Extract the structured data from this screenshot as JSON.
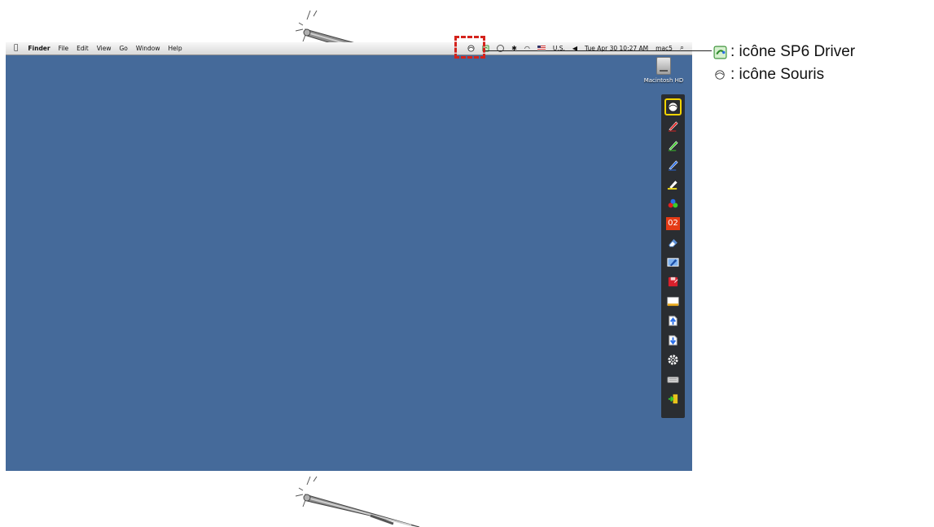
{
  "menubar": {
    "items": [
      "Finder",
      "File",
      "Edit",
      "View",
      "Go",
      "Window",
      "Help"
    ],
    "input_source": "U.S.",
    "clock": "Tue Apr 30  10:27 AM",
    "user": "mac5"
  },
  "desktop": {
    "hd_label": "Macintosh HD"
  },
  "toolbar": {
    "page_counter": "02",
    "tools": [
      "mouse-icon",
      "red-pen-icon",
      "green-pen-icon",
      "blue-pen-icon",
      "highlighter-icon",
      "color-palette-icon",
      "page-counter",
      "eraser-icon",
      "screen-capture-icon",
      "save-icon",
      "whiteboard-icon",
      "previous-page-icon",
      "next-page-icon",
      "settings-icon",
      "keyboard-icon",
      "exit-icon"
    ]
  },
  "legend": {
    "items": [
      {
        "icon": "sp6-driver-icon",
        "label": ": icône SP6 Driver"
      },
      {
        "icon": "mouse-icon",
        "label": ": icône Souris"
      }
    ]
  },
  "colors": {
    "desktop": "#456a9a",
    "highlight_dash": "#d4231c",
    "toolbar_bg": "#2a2d31",
    "selected_outline": "#f2d400",
    "page_counter_bg": "#e53b16"
  }
}
